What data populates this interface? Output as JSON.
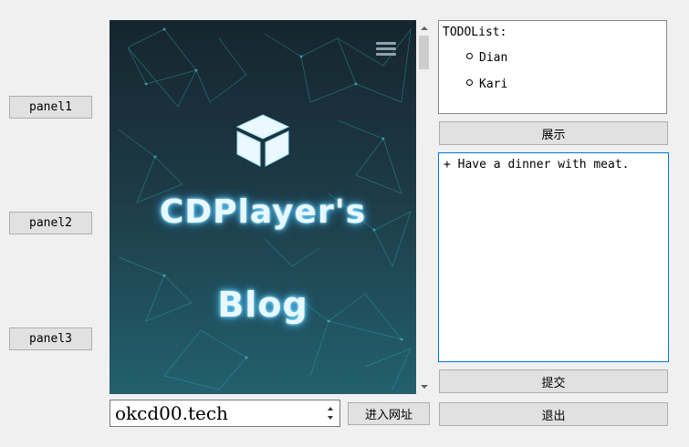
{
  "left_panel": {
    "panel1_label": "panel1",
    "panel2_label": "panel2",
    "panel3_label": "panel3"
  },
  "webview": {
    "title_line1": "CDPlayer's",
    "title_line2": "Blog",
    "icons": [
      "menu-icon",
      "cube-icon"
    ],
    "glow_color": "#6fd6ff"
  },
  "address": {
    "url_value": "okcd00.tech",
    "go_label": "进入网址"
  },
  "todo": {
    "title": "TODOList:",
    "items": [
      "Dian",
      "Kari"
    ]
  },
  "actions": {
    "show_label": "展示",
    "submit_label": "提交",
    "exit_label": "退出"
  },
  "note": {
    "text": "+ Have a dinner with meat."
  },
  "colors": {
    "focus_border": "#0078d7",
    "button_bg": "#e1e1e1"
  }
}
